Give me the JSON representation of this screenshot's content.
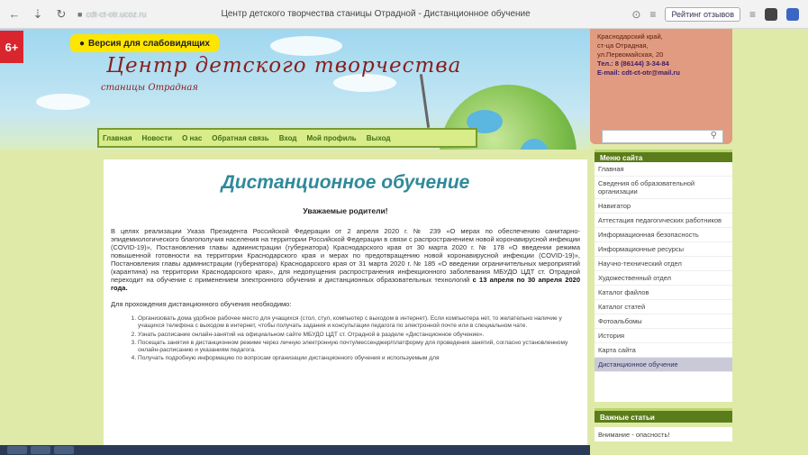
{
  "browser": {
    "url": "cdt-ct-otr.ucoz.ru",
    "tab_title": "Центр детского творчества станицы Отрадной - Дистанционное обучение",
    "review_label": "Рейтинг отзывов"
  },
  "header": {
    "age_badge": "6+",
    "vision_button": "Версия для слабовидящих",
    "title": "Центр детского творчества",
    "subtitle": "станицы Отрадная",
    "contact": {
      "line1": "Краснодарский край,",
      "line2": "ст-ца Отрадная,",
      "line3": "ул.Первомайская, 20",
      "phone": "Тел.: 8 (86144) 3-34-84",
      "email": "E-mail: cdt-ct-otr@mail.ru"
    }
  },
  "topnav": [
    "Главная",
    "Новости",
    "О нас",
    "Обратная связь",
    "Вход",
    "Мой профиль",
    "Выход"
  ],
  "main": {
    "title": "Дистанционное обучение",
    "greeting": "Уважаемые родители!",
    "paragraph": "В целях реализации Указа Президента Российской Федерации от 2 апреля 2020 г. № 239 «О мерах по обеспечению санитарно-эпидемиологического благополучия населения на территории Российской Федерации в связи с распространением новой коронавирусной инфекции (COVID-19)», Постановления главы администрации (губернатора) Краснодарского края от 30 марта 2020 г. № 178 «О введении режима повышенной готовности на территории Краснодарского края и мерах по предотвращению новой коронавирусной инфекции (COVID-19)», Постановления главы администрации (губернатора) Краснодарского края от 31 марта 2020 г. № 185 «О введении ограничительных мероприятий (карантина) на территории Краснодарского края», для недопущения распространения инфекционного заболевания МБУДО ЦДТ ст. Отрадной переходит на обучение с применением электронного обучения и дистанционных образовательных технологий",
    "paragraph_bold": "с 13 апреля по 30 апреля 2020 года.",
    "intro2": "Для прохождения дистанционного обучения необходимо:",
    "steps": [
      "Организовать дома удобное рабочее место для учащихся (стол, стул, компьютер с выходом в интернет). Если компьютера нет, то желательно наличие у учащихся телефона с выходом в интернет, чтобы получать задания и консультации педагога по электронной почте или в специальном чате.",
      "Узнать расписание онлайн-занятий на официальном сайте МБУДО ЦДТ ст. Отрадной в разделе «Дистанционное обучение».",
      "Посещать занятия в дистанционном режиме через личную электронную почту/мессенджер/платформу для проведения занятий, согласно установленному онлайн-расписанию и указаниям педагога.",
      "Получать подробную информацию по вопросам организации дистанционного обучения и используемым для"
    ]
  },
  "sidebar": {
    "menu_title": "Меню сайта",
    "items": [
      "Главная",
      "Сведения об образовательной организации",
      "Навигатор",
      "Аттестация педагогических работников",
      "Информационная безопасность",
      "Информационные ресурсы",
      "Научно-технический отдел",
      "Художественный отдел",
      "Каталог файлов",
      "Каталог статей",
      "Фотоальбомы",
      "История",
      "Карта сайта",
      "Дистанционное обучение"
    ],
    "important_title": "Важные статьи",
    "important_item": "Внимание - опасность!"
  }
}
